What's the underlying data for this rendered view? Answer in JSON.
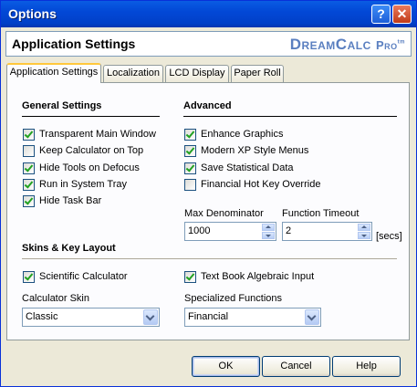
{
  "window": {
    "title": "Options",
    "help_glyph": "?",
    "close_glyph": "✕"
  },
  "header": {
    "title": "Application Settings",
    "brand_main": "DreamCalc",
    "brand_suffix": "Pro",
    "brand_tm": "tm"
  },
  "tabs": [
    {
      "label": "Application Settings",
      "active": true
    },
    {
      "label": "Localization",
      "active": false
    },
    {
      "label": "LCD Display",
      "active": false
    },
    {
      "label": "Paper Roll",
      "active": false
    }
  ],
  "general": {
    "heading": "General Settings",
    "items": [
      {
        "label": "Transparent Main Window",
        "checked": true
      },
      {
        "label": "Keep Calculator on Top",
        "checked": false
      },
      {
        "label": "Hide Tools on Defocus",
        "checked": true
      },
      {
        "label": "Run in System Tray",
        "checked": true
      },
      {
        "label": "Hide Task Bar",
        "checked": true
      }
    ]
  },
  "advanced": {
    "heading": "Advanced",
    "items": [
      {
        "label": "Enhance Graphics",
        "checked": true
      },
      {
        "label": "Modern XP Style Menus",
        "checked": true
      },
      {
        "label": "Save Statistical Data",
        "checked": true
      },
      {
        "label": "Financial Hot Key Override",
        "checked": false
      }
    ],
    "max_denominator": {
      "label": "Max Denominator",
      "value": "1000"
    },
    "function_timeout": {
      "label": "Function Timeout",
      "value": "2",
      "unit": "[secs]"
    }
  },
  "skins": {
    "heading": "Skins & Key Layout",
    "scientific": {
      "label": "Scientific Calculator",
      "checked": true
    },
    "textbook": {
      "label": "Text Book Algebraic Input",
      "checked": true
    },
    "calculator_skin": {
      "label": "Calculator Skin",
      "value": "Classic"
    },
    "specialized": {
      "label": "Specialized Functions",
      "value": "Financial"
    }
  },
  "buttons": {
    "ok": "OK",
    "cancel": "Cancel",
    "help": "Help"
  }
}
